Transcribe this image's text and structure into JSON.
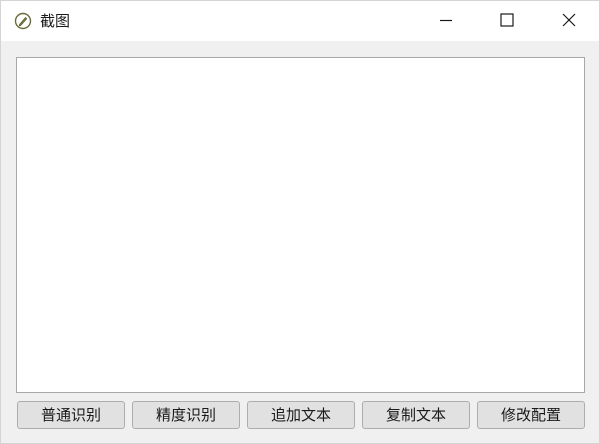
{
  "window": {
    "title": "截图",
    "controls": {
      "minimize_icon": "minimize-icon",
      "maximize_icon": "maximize-icon",
      "close_icon": "close-icon"
    }
  },
  "main": {
    "text_content": ""
  },
  "buttons": {
    "normal_ocr": "普通识别",
    "accurate_ocr": "精度识别",
    "append_text": "追加文本",
    "copy_text": "复制文本",
    "edit_config": "修改配置"
  },
  "colors": {
    "window_bg": "#f0f0f0",
    "titlebar_bg": "#ffffff",
    "button_bg": "#e1e1e1",
    "button_border": "#adadad",
    "text_area_border": "#a8a8a8"
  }
}
